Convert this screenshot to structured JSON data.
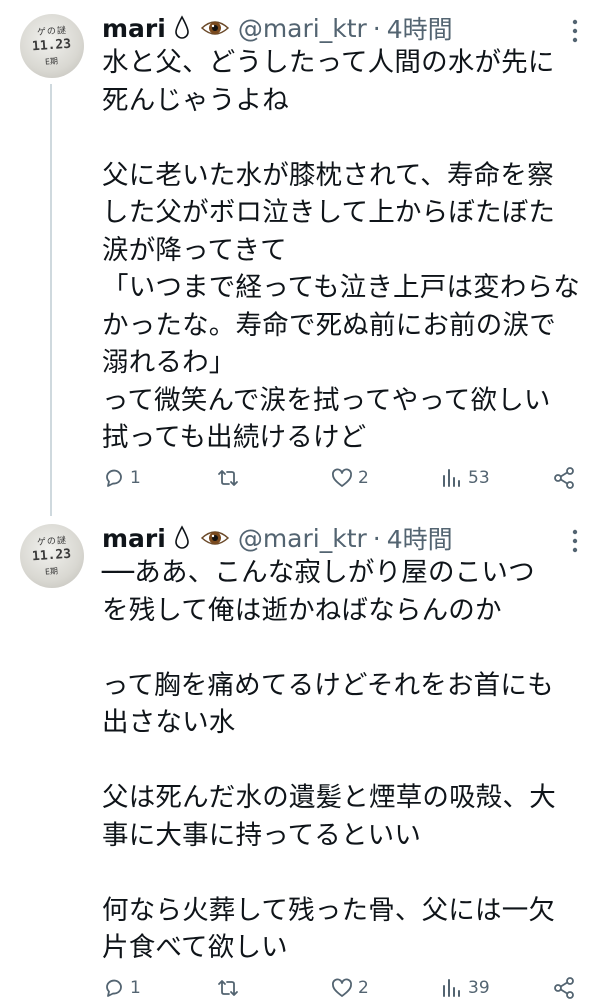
{
  "tweets": [
    {
      "author": {
        "name": "mari",
        "handle": "@mari_ktr",
        "time": "4時間"
      },
      "text": "水と父、どうしたって人間の水が先に\n死んじゃうよね\n\n父に老いた水が膝枕されて、寿命を察\nした父がボロ泣きして上からぼたぼた\n涙が降ってきて\n「いつまで経っても泣き上戸は変わらな\nかったな。寿命で死ぬ前にお前の涙で\n溺れるわ」\nって微笑んで涙を拭ってやって欲しい\n拭っても出続けるけど",
      "stats": {
        "replies": "1",
        "retweets": "",
        "likes": "2",
        "views": "53"
      }
    },
    {
      "author": {
        "name": "mari",
        "handle": "@mari_ktr",
        "time": "4時間"
      },
      "text": "──ああ、こんな寂しがり屋のこいつ\nを残して俺は逝かねばならんのか\n\nって胸を痛めてるけどそれをお首にも\n出さない水\n\n父は死んだ水の遺髪と煙草の吸殻、大\n事に大事に持ってるといい\n\n何なら火葬して残った骨、父には一欠\n片食べて欲しい",
      "stats": {
        "replies": "1",
        "retweets": "",
        "likes": "2",
        "views": "39"
      }
    }
  ],
  "separator": "·",
  "avatar_stamp": {
    "line1": "ゲの謎",
    "line2": "11.23",
    "line3": "E期"
  },
  "colors": {
    "text": "#0f1419",
    "muted": "#536471",
    "thread": "#cfd9de"
  }
}
